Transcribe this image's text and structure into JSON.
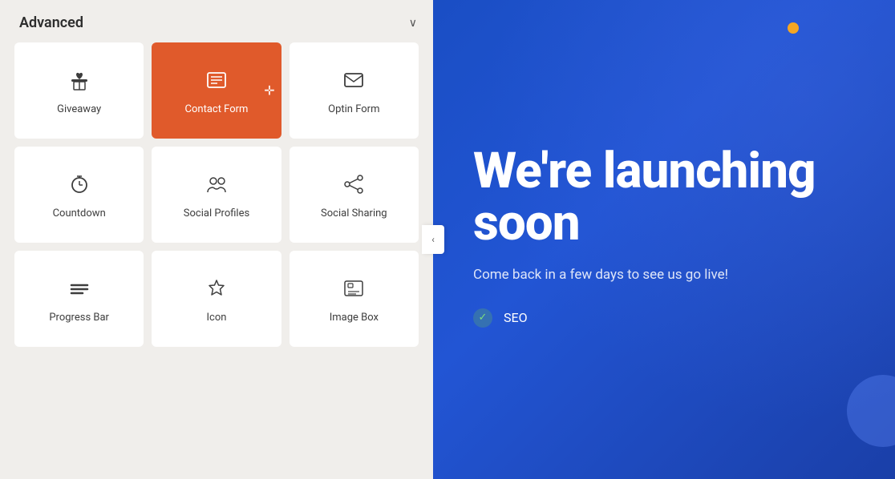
{
  "panel": {
    "title": "Advanced",
    "chevron": "∨"
  },
  "widgets": [
    {
      "id": "giveaway",
      "label": "Giveaway",
      "icon": "giveaway",
      "active": false
    },
    {
      "id": "contact-form",
      "label": "Contact Form",
      "icon": "contact-form",
      "active": true
    },
    {
      "id": "optin-form",
      "label": "Optin Form",
      "icon": "optin-form",
      "active": false
    },
    {
      "id": "countdown",
      "label": "Countdown",
      "icon": "countdown",
      "active": false
    },
    {
      "id": "social-profiles",
      "label": "Social Profiles",
      "icon": "social-profiles",
      "active": false
    },
    {
      "id": "social-sharing",
      "label": "Social Sharing",
      "icon": "social-sharing",
      "active": false
    },
    {
      "id": "progress-bar",
      "label": "Progress Bar",
      "icon": "progress-bar",
      "active": false
    },
    {
      "id": "icon",
      "label": "Icon",
      "icon": "icon",
      "active": false
    },
    {
      "id": "image-box",
      "label": "Image Box",
      "icon": "image-box",
      "active": false
    }
  ],
  "hero": {
    "heading": "We're launching soon",
    "subtext": "Come back in a few days to see us go live!",
    "features": [
      "SEO"
    ]
  },
  "collapse_arrow": "‹"
}
